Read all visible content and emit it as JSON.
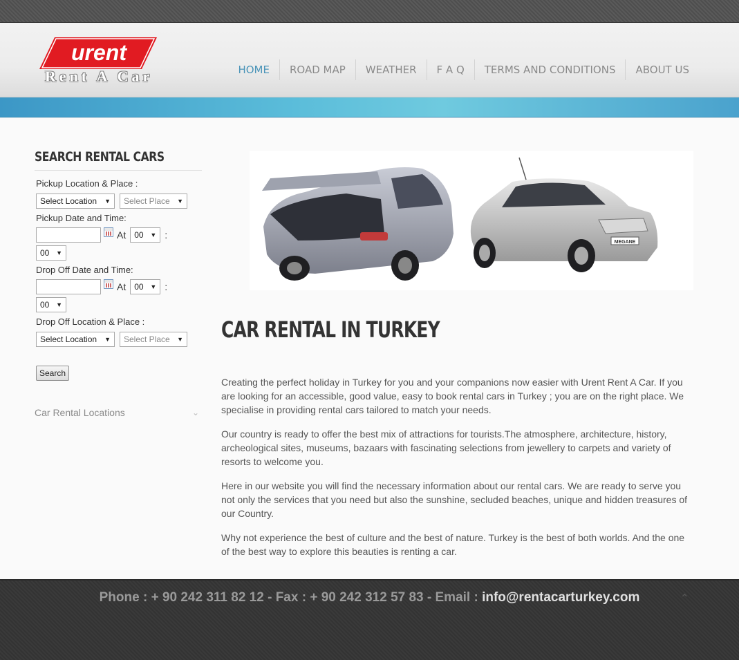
{
  "brand": {
    "logo_text": "urent",
    "logo_sub": "Rent A Car",
    "logo_color": "#e11b22"
  },
  "nav": [
    {
      "label": "HOME",
      "active": true
    },
    {
      "label": "ROAD MAP"
    },
    {
      "label": "WEATHER"
    },
    {
      "label": "F A Q"
    },
    {
      "label": "TERMS AND CONDITIONS"
    },
    {
      "label": "ABOUT US"
    }
  ],
  "sidebar": {
    "title": "SEARCH RENTAL CARS",
    "pickup_location_label": "Pickup Location & Place :",
    "pickup_location_select": "Select Location",
    "pickup_place_select": "Select Place",
    "pickup_time_label": "Pickup Date and Time:",
    "pickup_date_value": "",
    "pickup_at": "At",
    "pickup_hour": "00",
    "pickup_colon": ":",
    "pickup_minute": "00",
    "dropoff_time_label": "Drop Off Date and Time:",
    "dropoff_date_value": "",
    "dropoff_at": "At",
    "dropoff_hour": "00",
    "dropoff_colon": ":",
    "dropoff_minute": "00",
    "dropoff_location_label": "Drop Off Location & Place :",
    "dropoff_location_select": "Select Location",
    "dropoff_place_select": "Select Place",
    "search_button": "Search",
    "accordion_label": "Car Rental Locations"
  },
  "main": {
    "hero_car_badge": "MEGANE",
    "title": "CAR RENTAL IN TURKEY",
    "paragraphs": [
      "Creating the perfect holiday in Turkey for you and your companions now easier with Urent Rent A Car. If you are looking for an accessible, good value, easy to book rental cars in Turkey ; you are on the right place. We specialise in providing rental cars tailored to match your needs.",
      "Our country is ready to offer the best mix of attractions for tourists.The atmosphere, architecture, history, archeological sites, museums, bazaars with fascinating selections from jewellery to carpets and variety of resorts to welcome you.",
      "Here in our website you will find the necessary information about our rental cars. We are ready to serve you not only the services that you need but also the sunshine, secluded beaches, unique and hidden treasures of our Country.",
      "Why not experience the best of culture and the best of nature. Turkey is the best of both worlds. And the one of the best way to explore this beauties is renting a car."
    ]
  },
  "footer": {
    "contact_text": "Phone : + 90 242 311 82 12 - Fax : + 90 242 312 57 83 - Email : ",
    "email": "info@rentacarturkey.com"
  },
  "colors": {
    "accent_nav": "#4a94b8",
    "band": "#5bbdda"
  }
}
